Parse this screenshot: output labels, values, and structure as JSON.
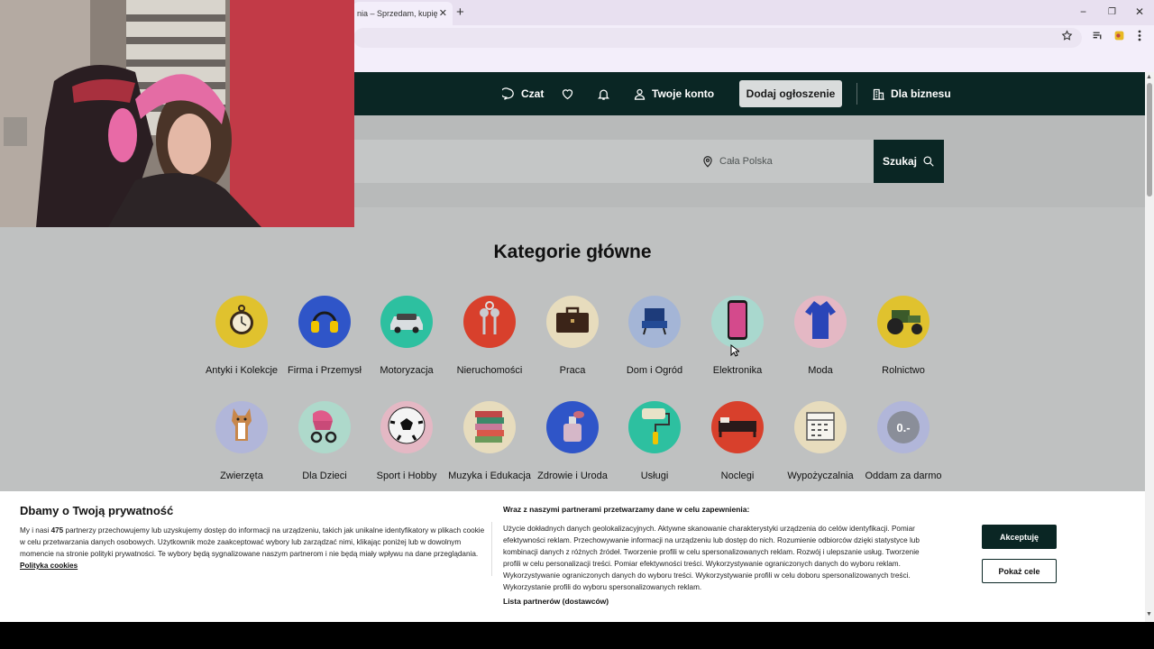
{
  "browser": {
    "tab_title": "nia – Sprzedam, kupię",
    "new_tab": "+",
    "win_minimize": "−",
    "win_restore": "❐",
    "win_close": "✕",
    "tab_close": "✕"
  },
  "header": {
    "chat": "Czat",
    "account": "Twoje konto",
    "add_listing": "Dodaj ogłoszenie",
    "business": "Dla biznesu"
  },
  "search": {
    "location_placeholder": "Cała Polska",
    "button": "Szukaj"
  },
  "main": {
    "title": "Kategorie główne",
    "categories_row1": [
      {
        "label": "Antyki i Kolekcje",
        "icon": "pocket-watch-icon",
        "bg": "#e0c22e"
      },
      {
        "label": "Firma i Przemysł",
        "icon": "headphones-icon",
        "bg": "#2f55c8"
      },
      {
        "label": "Motoryzacja",
        "icon": "car-icon",
        "bg": "#2dc0a0"
      },
      {
        "label": "Nieruchomości",
        "icon": "keys-icon",
        "bg": "#d8402c"
      },
      {
        "label": "Praca",
        "icon": "briefcase-icon",
        "bg": "#e7dcbd"
      },
      {
        "label": "Dom i Ogród",
        "icon": "armchair-icon",
        "bg": "#a4b5d6"
      },
      {
        "label": "Elektronika",
        "icon": "smartphone-icon",
        "bg": "#a9d8ce"
      },
      {
        "label": "Moda",
        "icon": "dress-icon",
        "bg": "#e4b8c4"
      },
      {
        "label": "Rolnictwo",
        "icon": "tractor-icon",
        "bg": "#e0c22e"
      }
    ],
    "categories_row2": [
      {
        "label": "Zwierzęta",
        "icon": "dog-icon",
        "bg": "#b1b6d9"
      },
      {
        "label": "Dla Dzieci",
        "icon": "stroller-icon",
        "bg": "#aed9cb"
      },
      {
        "label": "Sport i Hobby",
        "icon": "soccer-ball-icon",
        "bg": "#e4b8c4"
      },
      {
        "label": "Muzyka i Edukacja",
        "icon": "books-icon",
        "bg": "#e7dcbd"
      },
      {
        "label": "Zdrowie i Uroda",
        "icon": "perfume-icon",
        "bg": "#2f55c8"
      },
      {
        "label": "Usługi",
        "icon": "paint-roller-icon",
        "bg": "#2dc0a0"
      },
      {
        "label": "Noclegi",
        "icon": "bed-icon",
        "bg": "#d8402c"
      },
      {
        "label": "Wypożyczalnia",
        "icon": "calendar-icon",
        "bg": "#e7dcbd"
      },
      {
        "label": "Oddam za darmo",
        "icon": "price-tag-icon",
        "bg": "#b1b6d9",
        "tag_text": "0.-"
      }
    ]
  },
  "cookie": {
    "title": "Dbamy o Twoją prywatność",
    "text_before_count": "My i nasi ",
    "partner_count": "475",
    "text_after_count": " partnerzy przechowujemy lub uzyskujemy dostęp do informacji na urządzeniu, takich jak unikalne identyfikatory w plikach cookie w celu przetwarzania danych osobowych. Użytkownik może zaakceptować wybory lub zarządzać nimi, klikając poniżej lub w dowolnym momencie na stronie polityki prywatności. Te wybory będą sygnalizowane naszym partnerom i nie będą miały wpływu na dane przeglądania. ",
    "policy_link": "Polityka cookies",
    "right_title": "Wraz z naszymi partnerami przetwarzamy dane w celu zapewnienia:",
    "purposes": "Użycie dokładnych danych geolokalizacyjnych. Aktywne skanowanie charakterystyki urządzenia do celów identyfikacji. Pomiar efektywności reklam. Przechowywanie informacji na urządzeniu lub dostęp do nich. Rozumienie odbiorców dzięki statystyce lub kombinacji danych z różnych źródeł. Tworzenie profili w celu spersonalizowanych reklam. Rozwój i ulepszanie usług. Tworzenie profili w celu personalizacji treści. Pomiar efektywności treści. Wykorzystywanie ograniczonych danych do wyboru reklam. Wykorzystywanie ograniczonych danych do wyboru treści. Wykorzystywanie profili w celu doboru spersonalizowanych treści. Wykorzystanie profili do wyboru spersonalizowanych reklam.",
    "partners_link": "Lista partnerów (dostawców)",
    "accept": "Akceptuję",
    "show_purposes": "Pokaż cele"
  },
  "colors": {
    "brand_dark": "#0a2624",
    "page_bg": "#bfc1c1",
    "banner_bg": "#ffffff"
  }
}
